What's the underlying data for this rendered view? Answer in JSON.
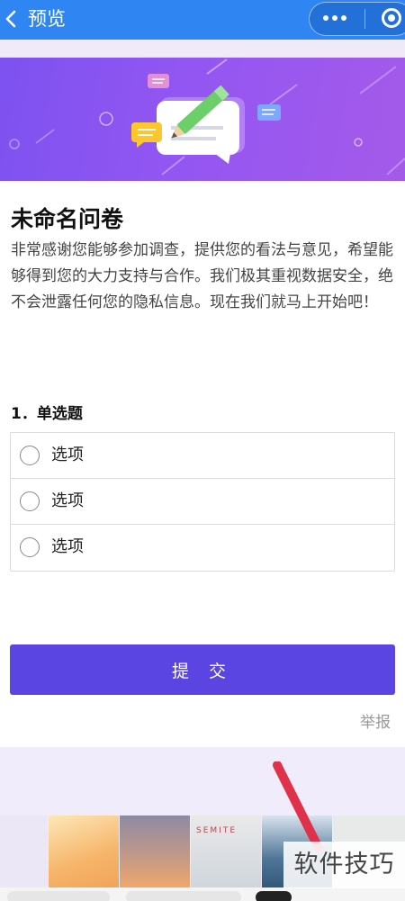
{
  "nav": {
    "back_icon": "back-chevron-icon",
    "title": "预览",
    "more_icon": "more-dots-icon",
    "close_icon": "close-miniprogram-icon",
    "bar_color": "#2f86f3"
  },
  "banner": {
    "gradient": [
      "#7d52f0",
      "#a45ae9"
    ],
    "icon": "chat-edit-illustration"
  },
  "survey": {
    "title": "未命名问卷",
    "description": "非常感谢您能够参加调查，提供您的看法与意见，希望能够得到您的大力支持与合作。我们极其重视数据安全，绝不会泄露任何您的隐私信息。现在我们就马上开始吧！"
  },
  "question": {
    "title": "1．单选题",
    "options": [
      "选项",
      "选项",
      "选项"
    ]
  },
  "actions": {
    "submit_label": "提 交",
    "report_label": "举报",
    "submit_color": "#5a45e3"
  },
  "overlay": {
    "thumb_text": "SEMITE",
    "watermark": "软件技巧",
    "arrow_color": "#e0314b"
  }
}
